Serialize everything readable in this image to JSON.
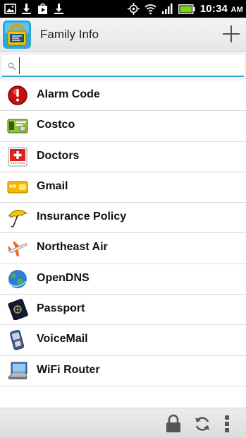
{
  "status_bar": {
    "time": "10:34",
    "ampm": "AM",
    "icons": [
      "image-icon",
      "download-icon",
      "play-store-icon",
      "download-icon",
      "gps-icon",
      "wifi-icon",
      "signal-icon",
      "battery-icon"
    ]
  },
  "action_bar": {
    "title": "Family Info",
    "app_icon": "lock-app-icon",
    "add_icon": "plus-icon"
  },
  "search": {
    "placeholder": "",
    "value": "",
    "icon": "search-icon"
  },
  "list": {
    "items": [
      {
        "label": "Alarm Code",
        "icon": "alarm-icon"
      },
      {
        "label": "Costco",
        "icon": "card-icon"
      },
      {
        "label": "Doctors",
        "icon": "medical-icon"
      },
      {
        "label": "Gmail",
        "icon": "password-icon"
      },
      {
        "label": "Insurance Policy",
        "icon": "umbrella-icon"
      },
      {
        "label": "Northeast Air",
        "icon": "airplane-icon"
      },
      {
        "label": "OpenDNS",
        "icon": "globe-icon"
      },
      {
        "label": "Passport",
        "icon": "passport-icon"
      },
      {
        "label": "VoiceMail",
        "icon": "phone-icon"
      },
      {
        "label": "WiFi Router",
        "icon": "computer-icon"
      }
    ]
  },
  "bottom_bar": {
    "icons": [
      "lock-icon",
      "sync-icon",
      "overflow-menu-icon"
    ]
  },
  "colors": {
    "accent": "#32a4d8",
    "status_bar": "#000000",
    "battery": "#7ed321"
  }
}
